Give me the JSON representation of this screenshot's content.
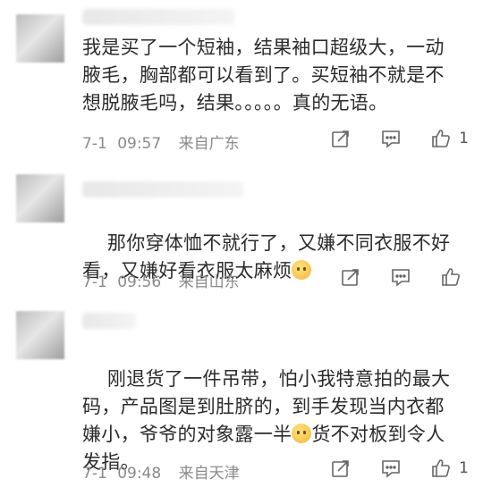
{
  "comments": [
    {
      "text": "我是买了一个短袖，结果袖口超级大，一动\n腋毛，胸部都可以看到了。买短袖不就是不\n想脱腋毛吗，结果。。。。。真的无语。",
      "date": "7-1",
      "time": "09:57",
      "location": "来自广东",
      "likes": "1"
    },
    {
      "text_a": "那你穿体恤不就行了，又嫌不同衣服不好\n看，又嫌好看衣服太麻烦",
      "emoji": "thinking-face",
      "date": "7-1",
      "time": "09:56",
      "location": "来自山东",
      "likes": ""
    },
    {
      "text_a": "刚退货了一件吊带，怕小我特意拍的最大\n码，产品图是到肚脐的，到手发现当内衣都\n嫌小，爷爷的对象露一半",
      "emoji": "thinking-face",
      "text_b": "货不对板到令人\n发指。",
      "date": "7-1",
      "time": "09:48",
      "location": "来自天津",
      "likes": "1"
    }
  ],
  "icons": {
    "share": "share-icon",
    "comment": "comment-icon",
    "like": "thumbs-up-icon"
  }
}
